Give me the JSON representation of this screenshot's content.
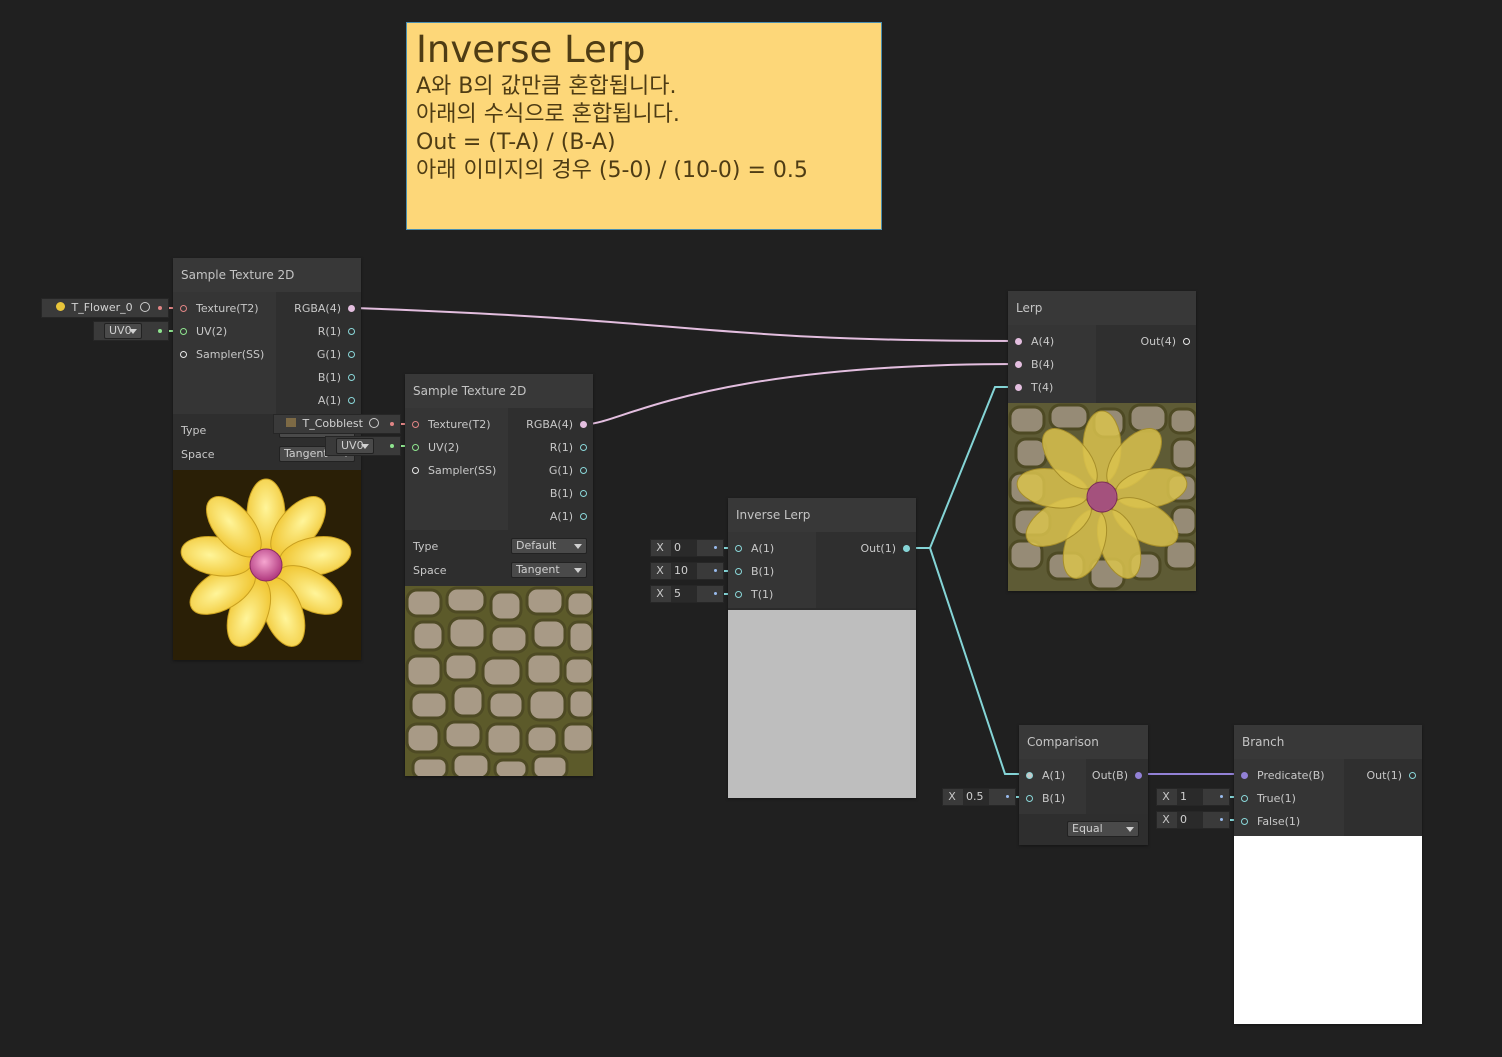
{
  "sticky_note": {
    "title": "Inverse Lerp",
    "lines": [
      "A와 B의 값만큼 혼합됩니다.",
      "아래의 수식으로 혼합됩니다.",
      "Out = (T-A) / (B-A)",
      "아래 이미지의 경우 (5-0) / (10-0) = 0.5"
    ]
  },
  "nodes": {
    "sample_tex_1": {
      "title": "Sample Texture 2D",
      "inputs": [
        "Texture(T2)",
        "UV(2)",
        "Sampler(SS)"
      ],
      "outputs": [
        "RGBA(4)",
        "R(1)",
        "G(1)",
        "B(1)",
        "A(1)"
      ],
      "type_label": "Type",
      "space_label": "Space",
      "type_value": "Default",
      "space_value": "Tangent",
      "texture_asset": "T_Flower_0",
      "uv_value": "UV0"
    },
    "sample_tex_2": {
      "title": "Sample Texture 2D",
      "inputs": [
        "Texture(T2)",
        "UV(2)",
        "Sampler(SS)"
      ],
      "outputs": [
        "RGBA(4)",
        "R(1)",
        "G(1)",
        "B(1)",
        "A(1)"
      ],
      "type_label": "Type",
      "space_label": "Space",
      "type_value": "Default",
      "space_value": "Tangent",
      "texture_asset": "T_Cobblest",
      "uv_value": "UV0"
    },
    "lerp": {
      "title": "Lerp",
      "inputs": [
        "A(4)",
        "B(4)",
        "T(4)"
      ],
      "outputs": [
        "Out(4)"
      ]
    },
    "inverse_lerp": {
      "title": "Inverse Lerp",
      "inputs": [
        "A(1)",
        "B(1)",
        "T(1)"
      ],
      "outputs": [
        "Out(1)"
      ],
      "input_values": [
        "0",
        "10",
        "5"
      ],
      "preview_color": "#bebebe"
    },
    "comparison": {
      "title": "Comparison",
      "inputs": [
        "A(1)",
        "B(1)"
      ],
      "outputs": [
        "Out(B)"
      ],
      "b_value": "0.5",
      "mode": "Equal"
    },
    "branch": {
      "title": "Branch",
      "inputs": [
        "Predicate(B)",
        "True(1)",
        "False(1)"
      ],
      "outputs": [
        "Out(1)"
      ],
      "true_value": "1",
      "false_value": "0",
      "preview_color": "#ffffff"
    }
  },
  "axis_label": "X",
  "colors": {
    "canvas": "#202020",
    "sticky_bg": "#fdd779",
    "wire_vec4": "#e3bedf",
    "wire_vec1": "#84d4d6",
    "wire_bool": "#9281d6",
    "wire_texture": "#e18585",
    "wire_uv": "#8fe58f"
  }
}
